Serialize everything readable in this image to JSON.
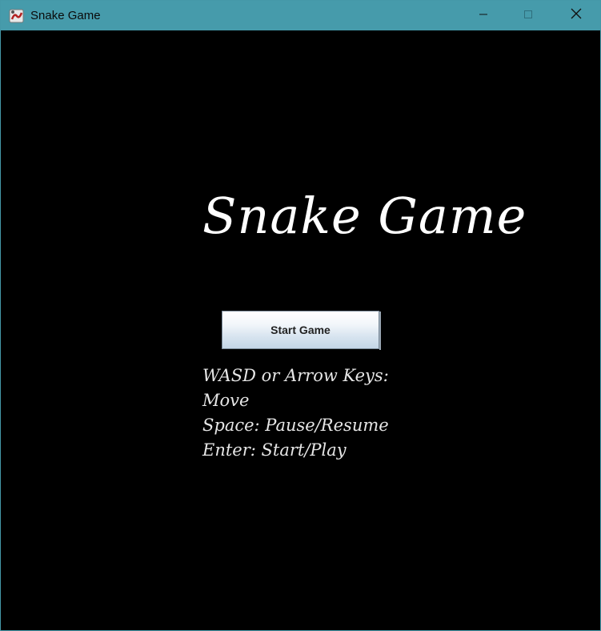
{
  "window": {
    "title": "Snake Game",
    "icon": "snake-app-icon"
  },
  "titlebar_controls": {
    "minimize_icon": "minimize-icon",
    "maximize_icon": "maximize-icon",
    "close_icon": "close-icon"
  },
  "game": {
    "title": "Snake Game",
    "start_button_label": "Start Game",
    "instructions": [
      "WASD or Arrow Keys:",
      "Move",
      "Space: Pause/Resume",
      "Enter: Start/Play"
    ]
  },
  "colors": {
    "titlebar": "#469bab",
    "background": "#000000",
    "text": "#ffffff"
  }
}
